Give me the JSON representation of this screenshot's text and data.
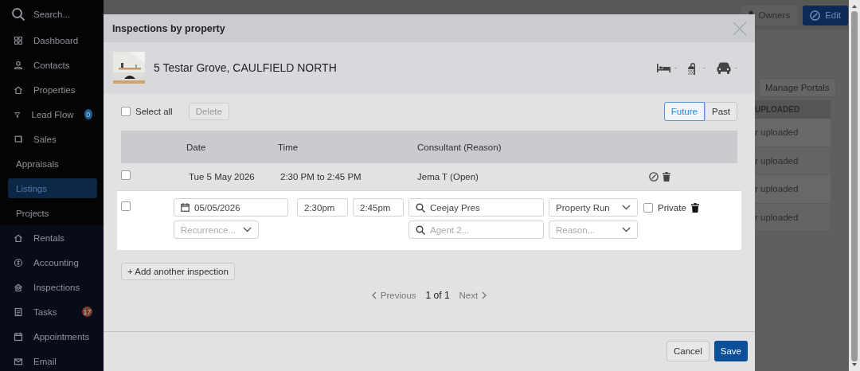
{
  "sidebar": {
    "search_placeholder": "Search...",
    "items": [
      {
        "label": "Dashboard",
        "selected": false
      },
      {
        "label": "Contacts",
        "selected": false
      },
      {
        "label": "Properties",
        "selected": false
      },
      {
        "label": "Lead Flow",
        "selected": false,
        "badge": "0",
        "color": "#1f5d99"
      },
      {
        "label": "Sales",
        "selected": false,
        "children": [
          {
            "label": "Appraisals",
            "selected": false
          },
          {
            "label": "Listings",
            "selected": true
          },
          {
            "label": "Projects",
            "selected": false
          }
        ]
      },
      {
        "label": "Rentals",
        "selected": false
      },
      {
        "label": "Accounting",
        "selected": false
      },
      {
        "label": "Inspections",
        "selected": false
      },
      {
        "label": "Tasks",
        "selected": false,
        "badge": "17",
        "color": "#7a3a2c"
      },
      {
        "label": "Appointments",
        "selected": false
      },
      {
        "label": "Email",
        "selected": false
      }
    ]
  },
  "background": {
    "buttons": [
      {
        "label": "Owners",
        "kind": "secondary"
      },
      {
        "label": "Edit",
        "kind": "primary"
      }
    ],
    "manage_button": "Manage Portals",
    "column": "UPLOADED",
    "rows": [
      "r uploaded",
      "r uploaded",
      "r uploaded",
      "r uploaded"
    ]
  },
  "modal": {
    "title": "Inspections by property",
    "property": {
      "kind": "picture",
      "address": "5 Testar Grove, CAULFIELD NORTH",
      "features": [
        "-",
        "-",
        "-"
      ]
    },
    "select_all": {
      "label": "Select all",
      "checked": false
    },
    "delete_button": {
      "label": "Delete",
      "disabled": true
    },
    "filter_tabs": [
      {
        "label": "Future",
        "selected": true
      },
      {
        "label": "Past",
        "selected": false
      }
    ],
    "columns": [
      "Date",
      "Time",
      "Consultant (Reason)"
    ],
    "rows": [
      {
        "checked": false,
        "date": "Tue 5 May 2026",
        "time": "2:30 PM to 2:45 PM",
        "consultant": "Jema T (Open)"
      }
    ],
    "editor": {
      "checked": false,
      "date": "05/05/2026",
      "recurrence_placeholder": "Recurrence...",
      "start_time": "2:30pm",
      "end_time": "2:45pm",
      "agent": "Ceejay Pres",
      "agent2_placeholder": "Agent 2...",
      "type": "Property Run",
      "reason_placeholder": "Reason...",
      "private": {
        "label": "Private",
        "checked": false
      }
    },
    "add_button": "+ Add another inspection",
    "pagination": {
      "previous": "Previous",
      "page": "1 of 1",
      "next": "Next"
    },
    "footer": {
      "cancel": "Cancel",
      "save": "Save"
    }
  }
}
